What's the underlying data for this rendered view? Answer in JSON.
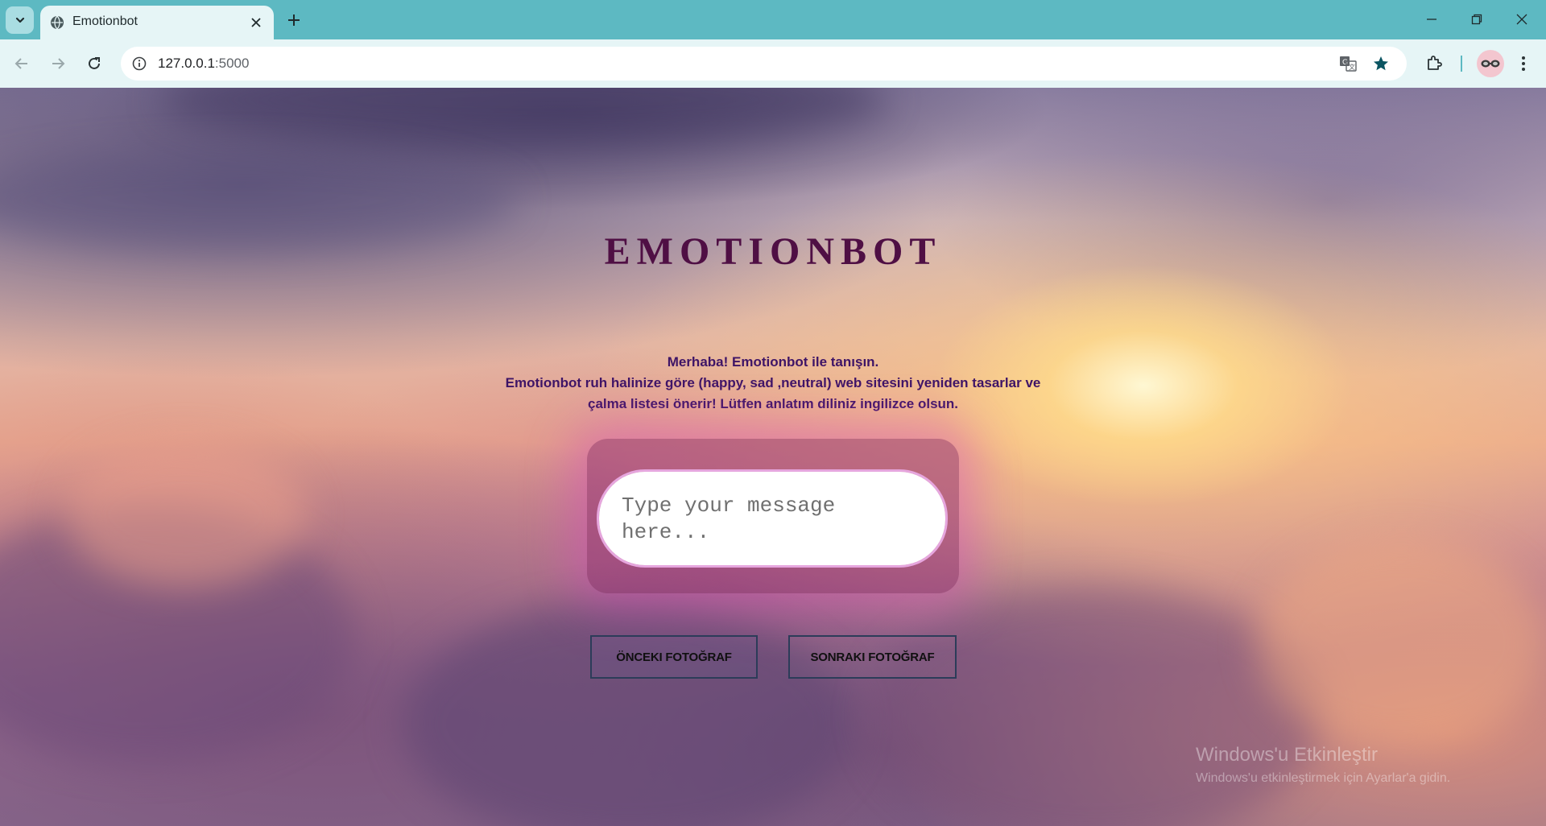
{
  "browser": {
    "tab_title": "Emotionbot",
    "url_host": "127.0.0.1",
    "url_port": ":5000"
  },
  "page": {
    "title": "EMOTIONBOT",
    "intro_line1": "Merhaba! Emotionbot ile tanışın.",
    "intro_line2": "Emotionbot ruh halinize göre (happy, sad ,neutral) web sitesini yeniden tasarlar ve",
    "intro_line3": "çalma listesi önerir! Lütfen anlatım diliniz ingilizce olsun.",
    "message_placeholder": "Type your message here...",
    "message_value": "",
    "prev_button": "ÖNCEKI FOTOĞRAF",
    "next_button": "SONRAKI FOTOĞRAF"
  },
  "watermark": {
    "title": "Windows'u Etkinleştir",
    "subtitle": "Windows'u etkinleştirmek için Ayarlar'a gidin."
  },
  "colors": {
    "chrome_frame": "#5db9c2",
    "toolbar": "#e6f5f6",
    "title": "#4f0f44",
    "intro_text": "#3e1466",
    "button_border": "#2c3c59",
    "input_border": "#e6a6de"
  },
  "icons": [
    "tab-search-icon",
    "globe-icon",
    "close-icon",
    "plus-icon",
    "minimize-icon",
    "restore-icon",
    "window-close-icon",
    "back-icon",
    "forward-icon",
    "reload-icon",
    "site-info-icon",
    "translate-icon",
    "star-icon",
    "extensions-icon",
    "kebab-menu-icon",
    "avatar"
  ]
}
